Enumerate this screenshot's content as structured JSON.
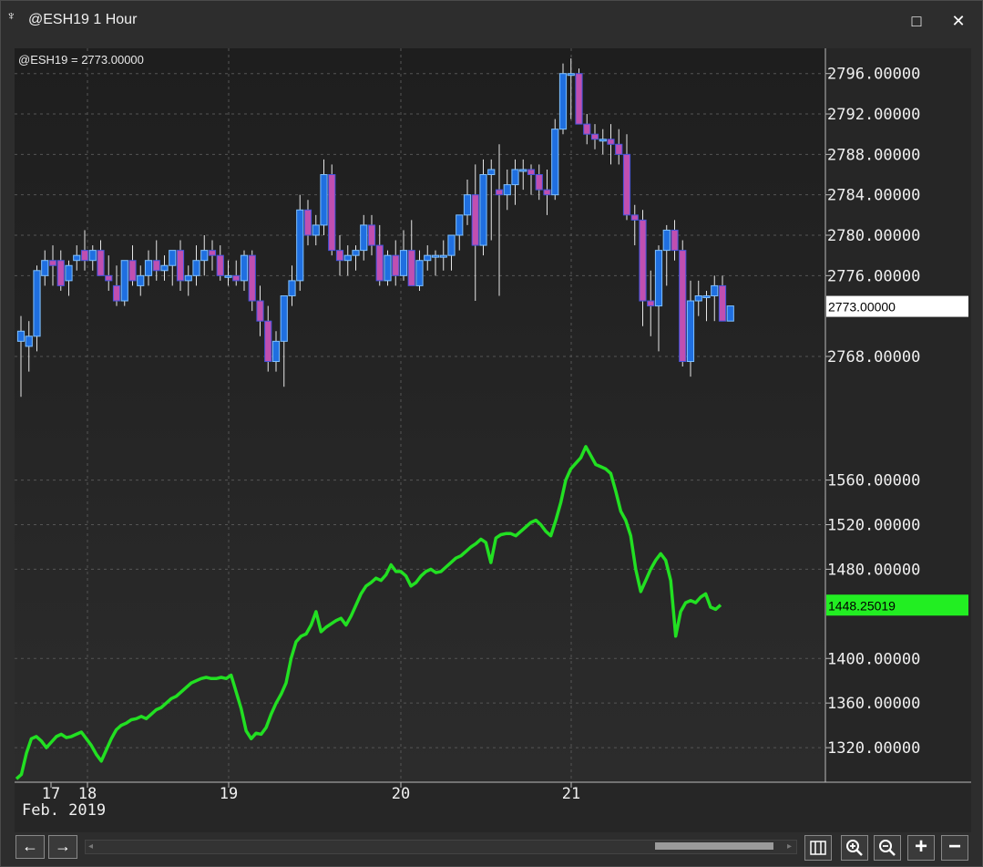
{
  "window": {
    "title": "@ESH19 1 Hour",
    "maximize_label": "□",
    "close_label": "✕"
  },
  "chart_info": {
    "symbol_readout": "@ESH19 = 2773.00000"
  },
  "chart_data": [
    {
      "type": "candlestick",
      "title": "@ESH19 1 Hour",
      "last_value_label": "2773.00000",
      "ylim": [
        2761.5,
        2798.5
      ],
      "yticks": [
        "2768.00000",
        "2776.00000",
        "2780.00000",
        "2784.00000",
        "2788.00000",
        "2792.00000",
        "2796.00000"
      ],
      "xticks": [
        "17",
        "18",
        "19",
        "20",
        "21"
      ],
      "xlabel_date": "Feb. 2019",
      "series": [
        {
          "ohlc": [
            [
              2769.5,
              2772.0,
              2764.0,
              2770.5
            ],
            [
              2769.0,
              2771.5,
              2766.5,
              2770.0
            ],
            [
              2770.0,
              2777.0,
              2768.5,
              2776.5
            ],
            [
              2776.0,
              2778.5,
              2775.0,
              2777.5
            ],
            [
              2777.5,
              2779.0,
              2775.0,
              2777.0
            ],
            [
              2777.5,
              2778.5,
              2774.5,
              2775.0
            ],
            [
              2775.5,
              2777.5,
              2774.0,
              2777.0
            ],
            [
              2777.5,
              2779.0,
              2776.5,
              2778.0
            ],
            [
              2778.5,
              2780.5,
              2776.5,
              2777.5
            ],
            [
              2777.5,
              2779.0,
              2776.5,
              2778.5
            ],
            [
              2778.5,
              2779.5,
              2776.5,
              2776.0
            ],
            [
              2776.0,
              2778.0,
              2774.5,
              2775.5
            ],
            [
              2775.0,
              2777.0,
              2773.0,
              2773.5
            ],
            [
              2773.5,
              2777.5,
              2773.0,
              2777.5
            ],
            [
              2777.5,
              2779.0,
              2775.0,
              2775.5
            ],
            [
              2775.0,
              2777.0,
              2774.0,
              2776.0
            ],
            [
              2776.0,
              2778.5,
              2775.0,
              2777.5
            ],
            [
              2777.5,
              2779.5,
              2775.5,
              2776.5
            ],
            [
              2776.5,
              2778.0,
              2775.5,
              2777.0
            ],
            [
              2777.0,
              2778.5,
              2775.0,
              2778.5
            ],
            [
              2778.5,
              2779.5,
              2774.5,
              2775.5
            ],
            [
              2775.5,
              2777.0,
              2774.0,
              2776.0
            ],
            [
              2776.0,
              2779.0,
              2775.0,
              2777.5
            ],
            [
              2777.5,
              2780.0,
              2776.0,
              2778.5
            ],
            [
              2778.5,
              2779.5,
              2776.5,
              2778.0
            ],
            [
              2778.0,
              2779.0,
              2775.5,
              2776.0
            ],
            [
              2776.0,
              2777.5,
              2775.0,
              2776.0
            ],
            [
              2776.0,
              2777.5,
              2775.0,
              2775.5
            ],
            [
              2775.5,
              2778.5,
              2774.5,
              2778.0
            ],
            [
              2778.0,
              2778.5,
              2772.5,
              2773.5
            ],
            [
              2773.5,
              2775.0,
              2770.0,
              2771.5
            ],
            [
              2771.5,
              2773.0,
              2766.5,
              2767.5
            ],
            [
              2767.5,
              2770.5,
              2766.5,
              2769.5
            ],
            [
              2769.5,
              2772.0,
              2765.0,
              2774.0
            ],
            [
              2774.0,
              2777.0,
              2773.0,
              2775.5
            ],
            [
              2775.5,
              2784.0,
              2774.5,
              2782.5
            ],
            [
              2782.5,
              2783.5,
              2779.0,
              2780.0
            ],
            [
              2780.0,
              2782.0,
              2779.0,
              2781.0
            ],
            [
              2781.0,
              2787.5,
              2780.0,
              2786.0
            ],
            [
              2786.0,
              2787.0,
              2778.0,
              2778.5
            ],
            [
              2778.5,
              2780.0,
              2776.0,
              2777.5
            ],
            [
              2777.5,
              2779.0,
              2776.0,
              2778.0
            ],
            [
              2778.0,
              2779.0,
              2776.5,
              2778.5
            ],
            [
              2778.5,
              2782.0,
              2777.5,
              2781.0
            ],
            [
              2781.0,
              2782.0,
              2778.0,
              2779.0
            ],
            [
              2779.0,
              2781.0,
              2775.0,
              2775.5
            ],
            [
              2775.5,
              2778.5,
              2775.0,
              2778.0
            ],
            [
              2778.0,
              2779.5,
              2775.0,
              2776.0
            ],
            [
              2776.0,
              2780.5,
              2775.5,
              2778.5
            ],
            [
              2778.5,
              2781.5,
              2775.0,
              2775.0
            ],
            [
              2775.0,
              2778.5,
              2774.5,
              2777.5
            ],
            [
              2777.5,
              2779.0,
              2776.5,
              2778.0
            ],
            [
              2778.0,
              2778.5,
              2776.0,
              2778.0
            ],
            [
              2778.0,
              2779.5,
              2776.5,
              2778.0
            ],
            [
              2778.0,
              2780.0,
              2776.5,
              2780.0
            ],
            [
              2780.0,
              2782.0,
              2778.5,
              2782.0
            ],
            [
              2782.0,
              2785.5,
              2781.0,
              2784.0
            ],
            [
              2784.0,
              2787.0,
              2773.5,
              2779.0
            ],
            [
              2779.0,
              2787.5,
              2778.0,
              2786.0
            ],
            [
              2786.0,
              2787.5,
              2779.5,
              2786.5
            ],
            [
              2784.5,
              2789.0,
              2774.0,
              2784.0
            ],
            [
              2784.0,
              2786.5,
              2782.5,
              2785.0
            ],
            [
              2785.0,
              2787.5,
              2783.0,
              2786.5
            ],
            [
              2786.5,
              2787.5,
              2784.5,
              2786.5
            ],
            [
              2786.5,
              2787.0,
              2784.0,
              2786.0
            ],
            [
              2786.0,
              2787.0,
              2783.5,
              2784.5
            ],
            [
              2784.5,
              2786.5,
              2782.0,
              2784.0
            ],
            [
              2784.0,
              2791.5,
              2783.5,
              2790.5
            ],
            [
              2790.5,
              2797.0,
              2790.0,
              2796.0
            ],
            [
              2796.0,
              2797.5,
              2791.5,
              2796.0
            ],
            [
              2796.0,
              2796.5,
              2791.0,
              2791.0
            ],
            [
              2791.0,
              2792.0,
              2789.0,
              2790.0
            ],
            [
              2790.0,
              2791.0,
              2788.5,
              2789.5
            ],
            [
              2789.5,
              2790.5,
              2788.0,
              2789.5
            ],
            [
              2789.5,
              2791.0,
              2787.0,
              2789.0
            ],
            [
              2789.0,
              2790.5,
              2787.0,
              2788.0
            ],
            [
              2788.0,
              2790.0,
              2781.5,
              2782.0
            ],
            [
              2782.0,
              2783.0,
              2779.0,
              2781.5
            ],
            [
              2781.5,
              2782.5,
              2771.0,
              2773.5
            ],
            [
              2773.5,
              2776.5,
              2770.0,
              2773.0
            ],
            [
              2773.0,
              2779.0,
              2768.5,
              2778.5
            ],
            [
              2778.5,
              2781.0,
              2775.0,
              2780.5
            ],
            [
              2780.5,
              2781.5,
              2777.5,
              2778.5
            ],
            [
              2778.5,
              2779.5,
              2767.0,
              2767.5
            ],
            [
              2767.5,
              2775.5,
              2766.0,
              2773.5
            ],
            [
              2773.5,
              2775.5,
              2772.0,
              2774.0
            ],
            [
              2774.0,
              2774.5,
              2771.5,
              2774.0
            ],
            [
              2774.0,
              2776.0,
              2771.5,
              2775.0
            ],
            [
              2775.0,
              2776.0,
              2771.5,
              2771.5
            ],
            [
              2771.5,
              2773.0,
              2771.5,
              2773.0
            ]
          ]
        }
      ]
    },
    {
      "type": "line",
      "last_value_label": "1448.25019",
      "ylim": [
        1289,
        1612
      ],
      "yticks": [
        "1320.00000",
        "1360.00000",
        "1400.00000",
        "1480.00000",
        "1520.00000",
        "1560.00000"
      ],
      "series": [
        {
          "values": [
            1292,
            1296,
            1315,
            1328,
            1330,
            1326,
            1320,
            1325,
            1330,
            1332,
            1329,
            1330,
            1332,
            1334,
            1328,
            1322,
            1314,
            1308,
            1318,
            1328,
            1336,
            1340,
            1342,
            1345,
            1346,
            1348,
            1346,
            1350,
            1354,
            1356,
            1360,
            1364,
            1366,
            1370,
            1374,
            1378,
            1380,
            1382,
            1383,
            1382,
            1382,
            1383,
            1382,
            1385,
            1370,
            1355,
            1335,
            1328,
            1333,
            1332,
            1338,
            1350,
            1360,
            1368,
            1378,
            1400,
            1415,
            1420,
            1422,
            1430,
            1442,
            1424,
            1428,
            1431,
            1434,
            1436,
            1430,
            1438,
            1448,
            1458,
            1465,
            1468,
            1472,
            1470,
            1475,
            1484,
            1478,
            1478,
            1474,
            1465,
            1468,
            1474,
            1478,
            1480,
            1477,
            1478,
            1482,
            1486,
            1490,
            1492,
            1496,
            1500,
            1503,
            1507,
            1504,
            1486,
            1508,
            1511,
            1512,
            1512,
            1510,
            1514,
            1518,
            1522,
            1524,
            1520,
            1514,
            1510,
            1524,
            1540,
            1560,
            1570,
            1575,
            1580,
            1590,
            1582,
            1574,
            1572,
            1570,
            1566,
            1550,
            1532,
            1524,
            1510,
            1480,
            1460,
            1470,
            1480,
            1488,
            1494,
            1488,
            1470,
            1420,
            1442,
            1450,
            1452,
            1450,
            1455,
            1458,
            1446,
            1444,
            1448
          ]
        }
      ]
    }
  ],
  "bottom_toolbar": {
    "left_label": "←",
    "right_label": "→",
    "scroll_left": "◂",
    "scroll_right": "▸",
    "zoom_in_label": "🔍",
    "zoom_out_label": "🔍",
    "plus_label": "+",
    "minus_label": "−"
  },
  "colors": {
    "bull_body": "#1f6fe0",
    "bear_body": "#c04fb0",
    "line": "#22e022",
    "last_price_bg": "#ffffff",
    "last_line_bg": "#22ee22"
  }
}
